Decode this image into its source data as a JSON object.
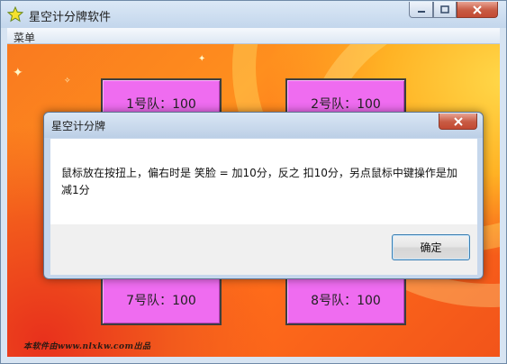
{
  "window": {
    "title": "星空计分牌软件",
    "menu": [
      "菜单"
    ]
  },
  "teams": [
    {
      "label": "1号队：100"
    },
    {
      "label": "2号队：100"
    },
    {
      "label": "7号队：100"
    },
    {
      "label": "8号队：100"
    }
  ],
  "watermark": "本软件由www.nlxkw.com出品",
  "dialog": {
    "title": "星空计分牌",
    "message": "鼠标放在按扭上，偏右时是 笑脸 = 加10分，反之 扣10分，另点鼠标中键操作是加减1分",
    "ok_label": "确定"
  },
  "colors": {
    "team_button": "#ef6cf0",
    "background_orange": "#ff8f1e",
    "background_yellow": "#ffd94a"
  },
  "icons": {
    "app": "star-icon",
    "minimize": "minimize-icon",
    "maximize": "maximize-icon",
    "close": "close-icon"
  }
}
